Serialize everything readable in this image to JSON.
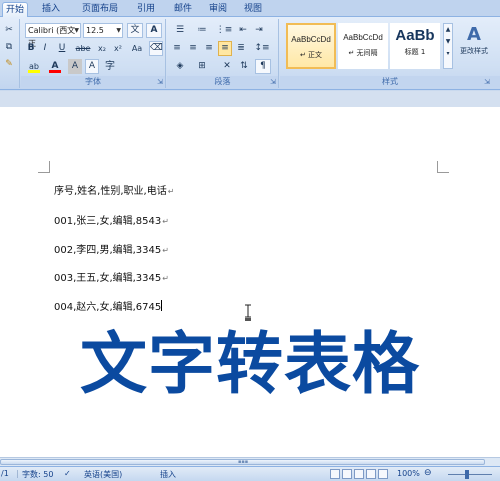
{
  "tabs": [
    "开始",
    "插入",
    "页面布局",
    "引用",
    "邮件",
    "审阅",
    "视图"
  ],
  "ribbon": {
    "font": {
      "name": "Calibri (西文正",
      "size": "12.5",
      "label": "字体",
      "pinyin": "文",
      "grow": "A",
      "bold": "B",
      "italic": "I",
      "underline": "U",
      "strike": "abe",
      "sub": "x₂",
      "sup": "x²",
      "clear": "Aa",
      "highlight": "ab",
      "fontcolor": "A",
      "charshade": "A",
      "enclose": "字"
    },
    "paragraph": {
      "label": "段落"
    },
    "styles": {
      "label": "样式",
      "items": [
        {
          "preview": "AaBbCcDd",
          "name": "↵ 正文"
        },
        {
          "preview": "AaBbCcDd",
          "name": "↵ 无间隔"
        },
        {
          "preview": "AaBb",
          "name": "标题 1"
        }
      ],
      "change": "更改样式"
    }
  },
  "document": {
    "lines": [
      "序号,姓名,性别,职业,电话",
      "001,张三,女,编辑,8543",
      "002,李四,男,编辑,3345",
      "003,王五,女,编辑,3345",
      "004,赵六,女,编辑,6745"
    ],
    "paragraph_mark": "↵",
    "overlay_title": "文字转表格"
  },
  "status": {
    "page": "/1",
    "words": "字数: 50",
    "language": "英语(美国)",
    "mode": "插入",
    "zoom": "100%",
    "zoom_minus": "⊖",
    "zoom_plus": "⊕"
  },
  "colors": {
    "accent": "#0b4aa0",
    "highlight_bar": "#ffff00",
    "font_color_bar": "#ff0000"
  }
}
